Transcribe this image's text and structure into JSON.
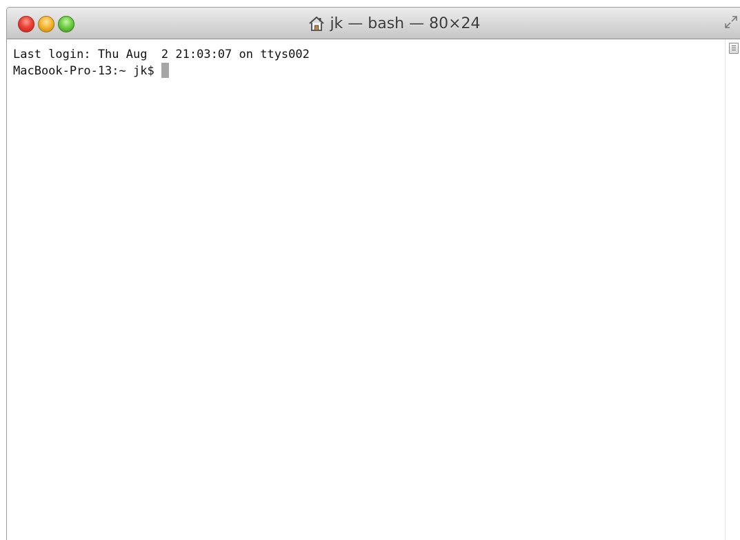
{
  "window": {
    "title": "jk — bash — 80×24",
    "controls": {
      "close": "close-button",
      "minimize": "minimize-button",
      "zoom": "zoom-button"
    },
    "icons": {
      "title": "home-icon",
      "fullscreen": "fullscreen-icon",
      "split": "split-view-icon"
    }
  },
  "terminal": {
    "lines": [
      "Last login: Thu Aug  2 21:03:07 on ttys002",
      "MacBook-Pro-13:~ jk$ "
    ]
  },
  "colors": {
    "close": "#ee4237",
    "minimize": "#f5b733",
    "zoom": "#6fcf45",
    "cursor": "#a6a6a6",
    "text": "#111111",
    "background": "#ffffff"
  }
}
